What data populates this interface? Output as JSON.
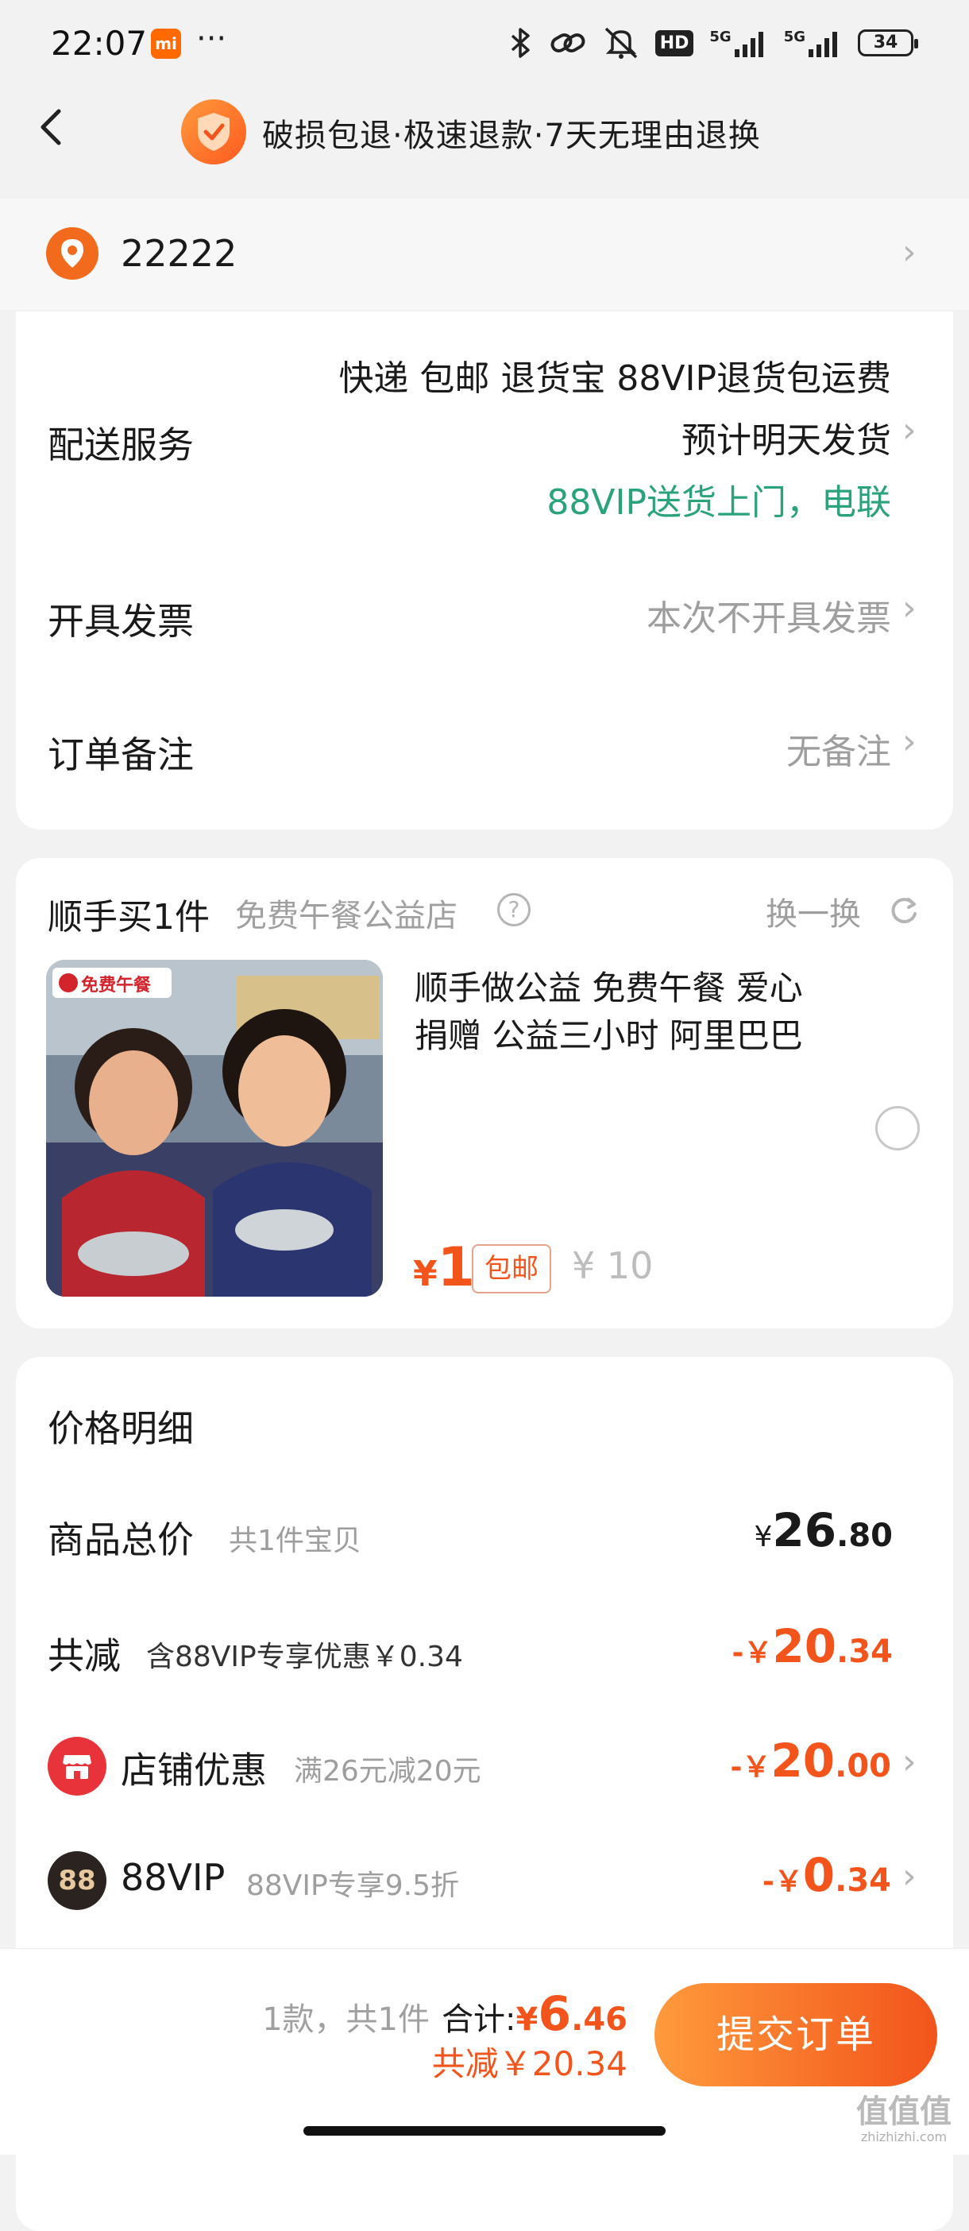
{
  "status_bar": {
    "time": "22:07",
    "mi_label": "mi",
    "more": "···",
    "network_1": "5G",
    "network_2": "5G",
    "hd": "HD",
    "battery": "34"
  },
  "header": {
    "title": "破损包退·极速退款·7天无理由退换",
    "back_icon": "chevron-left-icon",
    "badge_icon": "shield-check-icon"
  },
  "address": {
    "text": "22222"
  },
  "delivery": {
    "label": "配送服务",
    "services": "快递 包邮 退货宝 88VIP退货包运费",
    "ship_time": "预计明天发货",
    "vip_note": "88VIP送货上门，电联"
  },
  "invoice": {
    "label": "开具发票",
    "value": "本次不开具发票"
  },
  "note": {
    "label": "订单备注",
    "value": "无备注"
  },
  "addon": {
    "title": "顺手买1件",
    "shop": "免费午餐公益店",
    "switch_label": "换一换",
    "product_name_line1": "顺手做公益 免费午餐 爱心",
    "product_name_line2": "捐赠 公益三小时 阿里巴巴",
    "price_symbol": "¥",
    "price": "1",
    "tag": "包邮",
    "original_price": "¥ 10",
    "image_logo": "免费午餐"
  },
  "price_detail": {
    "title": "价格明细",
    "total_label": "商品总价",
    "total_sub": "共1件宝贝",
    "total_symbol": "¥",
    "total_int": "26",
    "total_dec": ".80",
    "discount_label": "共减",
    "discount_sub": "含88VIP专享优惠￥0.34",
    "discount_prefix": "-￥",
    "discount_int": "20",
    "discount_dec": ".34",
    "shop_coupon_label": "店铺优惠",
    "shop_coupon_sub": "满26元减20元",
    "shop_coupon_prefix": "-￥",
    "shop_coupon_int": "20",
    "shop_coupon_dec": ".00",
    "vip_label": "88VIP",
    "vip_sub": "88VIP专享9.5折",
    "vip_prefix": "-￥",
    "vip_int": "0",
    "vip_dec": ".34",
    "vip_badge": "88"
  },
  "bottom": {
    "count": "1款，共1件",
    "total_label": "合计:",
    "total_symbol": "¥",
    "total_int": "6",
    "total_dec": ".46",
    "saved": "共减￥20.34",
    "submit": "提交订单"
  },
  "watermark": {
    "line1": "值值值",
    "line2": "zhizhizhi.com"
  },
  "colors": {
    "accent": "#f2541b",
    "green": "#2aa27a"
  }
}
